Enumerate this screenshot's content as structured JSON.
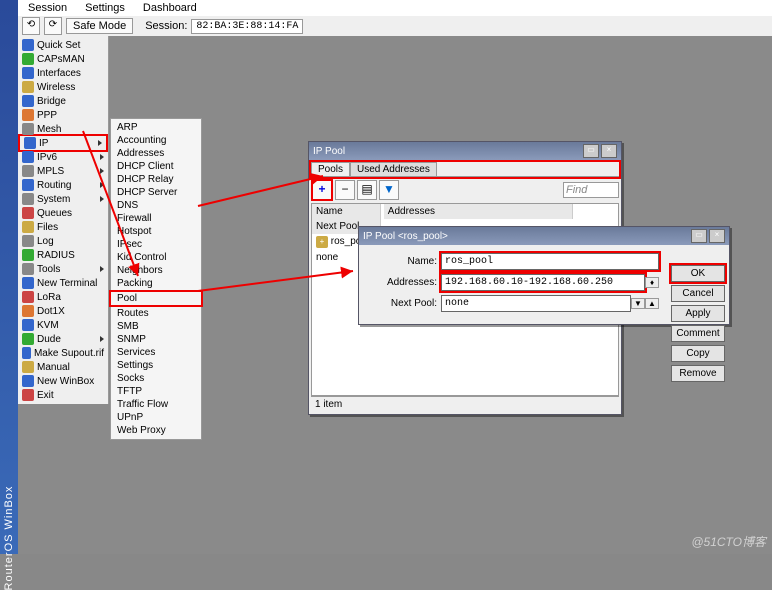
{
  "banner": "RouterOS WinBox",
  "menubar": [
    "Session",
    "Settings",
    "Dashboard"
  ],
  "toolbar": {
    "safemode": "Safe Mode",
    "sesslabel": "Session:",
    "session": "82:BA:3E:88:14:FA"
  },
  "sidebar": [
    {
      "label": "Quick Set",
      "c": "blu"
    },
    {
      "label": "CAPsMAN",
      "c": "grn"
    },
    {
      "label": "Interfaces",
      "c": "blu"
    },
    {
      "label": "Wireless",
      "c": "yel"
    },
    {
      "label": "Bridge",
      "c": "blu"
    },
    {
      "label": "PPP",
      "c": "org"
    },
    {
      "label": "Mesh",
      "c": "gry"
    },
    {
      "label": "IP",
      "c": "blu",
      "sub": true,
      "hl": true
    },
    {
      "label": "IPv6",
      "c": "blu",
      "sub": true
    },
    {
      "label": "MPLS",
      "c": "gry",
      "sub": true
    },
    {
      "label": "Routing",
      "c": "blu",
      "sub": true
    },
    {
      "label": "System",
      "c": "gry",
      "sub": true
    },
    {
      "label": "Queues",
      "c": "red"
    },
    {
      "label": "Files",
      "c": "yel"
    },
    {
      "label": "Log",
      "c": "gry"
    },
    {
      "label": "RADIUS",
      "c": "grn"
    },
    {
      "label": "Tools",
      "c": "gry",
      "sub": true
    },
    {
      "label": "New Terminal",
      "c": "blu"
    },
    {
      "label": "LoRa",
      "c": "red"
    },
    {
      "label": "Dot1X",
      "c": "org"
    },
    {
      "label": "KVM",
      "c": "blu"
    },
    {
      "label": "Dude",
      "c": "grn",
      "sub": true
    },
    {
      "label": "Make Supout.rif",
      "c": "blu"
    },
    {
      "label": "Manual",
      "c": "yel"
    },
    {
      "label": "New WinBox",
      "c": "blu"
    },
    {
      "label": "Exit",
      "c": "red"
    }
  ],
  "submenu": [
    "ARP",
    "Accounting",
    "Addresses",
    "DHCP Client",
    "DHCP Relay",
    "DHCP Server",
    "DNS",
    "Firewall",
    "Hotspot",
    "IPsec",
    "Kid Control",
    "Neighbors",
    "Packing",
    "Pool",
    "Routes",
    "SMB",
    "SNMP",
    "Services",
    "Settings",
    "Socks",
    "TFTP",
    "Traffic Flow",
    "UPnP",
    "Web Proxy"
  ],
  "submenu_hl": "Pool",
  "poolwin": {
    "title": "IP Pool",
    "tabs": [
      "Pools",
      "Used Addresses"
    ],
    "cols": [
      "Name",
      "Addresses",
      "Next Pool"
    ],
    "row": {
      "name": "ros_pool",
      "addr": "192.168.60.10-192.168.60.250",
      "next": "none"
    },
    "find": "Find",
    "status": "1 item"
  },
  "editwin": {
    "title": "IP Pool <ros_pool>",
    "name_lbl": "Name:",
    "name_val": "ros_pool",
    "addr_lbl": "Addresses:",
    "addr_val": "192.168.60.10-192.168.60.250",
    "next_lbl": "Next Pool:",
    "next_val": "none",
    "buttons": [
      "OK",
      "Cancel",
      "Apply",
      "Comment",
      "Copy",
      "Remove"
    ]
  },
  "watermark": "@51CTO博客"
}
